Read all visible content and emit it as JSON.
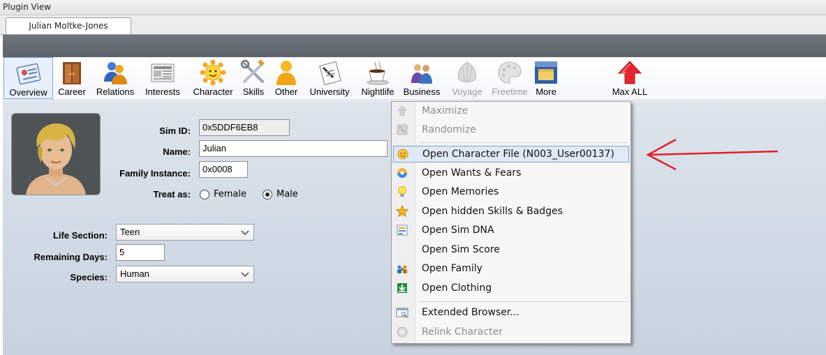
{
  "window": {
    "title": "Plugin View"
  },
  "tabs": [
    {
      "label": "Julian Moltke-Jones"
    }
  ],
  "toolbar": {
    "buttons": [
      {
        "label": "Overview",
        "icon": "overview-card-icon",
        "selected": true
      },
      {
        "label": "Career",
        "icon": "career-door-icon"
      },
      {
        "label": "Relations",
        "icon": "relations-people-icon"
      },
      {
        "label": "Interests",
        "icon": "interests-newspaper-icon"
      },
      {
        "label": "Character",
        "icon": "character-sun-icon"
      },
      {
        "label": "Skills",
        "icon": "skills-tools-icon"
      },
      {
        "label": "Other",
        "icon": "other-person-icon"
      },
      {
        "label": "University",
        "icon": "university-diploma-icon"
      },
      {
        "label": "Nightlife",
        "icon": "nightlife-cup-icon"
      },
      {
        "label": "Business",
        "icon": "business-people-icon"
      },
      {
        "label": "Voyage",
        "icon": "voyage-shell-icon",
        "disabled": true
      },
      {
        "label": "Freetime",
        "icon": "freetime-palette-icon",
        "disabled": true
      },
      {
        "label": "More",
        "icon": "more-folder-icon"
      },
      {
        "label": "Max ALL",
        "icon": "max-all-arrow-icon"
      }
    ]
  },
  "form": {
    "sim_id": {
      "label": "Sim ID:",
      "value": "0x5DDF6EB8"
    },
    "name": {
      "label": "Name:",
      "value": "Julian"
    },
    "family_instance": {
      "label": "Family Instance:",
      "value": "0x0008"
    },
    "treat_as": {
      "label": "Treat as:",
      "female": "Female",
      "male": "Male",
      "selected": "Male"
    },
    "life_section": {
      "label": "Life Section:",
      "value": "Teen"
    },
    "remaining_days": {
      "label": "Remaining Days:",
      "value": "5"
    },
    "species": {
      "label": "Species:",
      "value": "Human"
    }
  },
  "context_menu": {
    "items": [
      {
        "label": "Maximize",
        "icon": "maximize-arrow-icon",
        "disabled": true
      },
      {
        "label": "Randomize",
        "icon": "randomize-dice-icon",
        "disabled": true
      },
      {
        "label": "Open Character File (N003_User00137)",
        "icon": "character-file-icon",
        "highlighted": true
      },
      {
        "label": "Open Wants & Fears",
        "icon": "wants-fears-icon"
      },
      {
        "label": "Open Memories",
        "icon": "memories-lightbulb-icon"
      },
      {
        "label": "Open hidden Skills & Badges",
        "icon": "star-icon"
      },
      {
        "label": "Open Sim DNA",
        "icon": "sim-dna-icon"
      },
      {
        "label": "Open Sim Score",
        "icon": ""
      },
      {
        "label": "Open Family",
        "icon": "family-icon"
      },
      {
        "label": "Open Clothing",
        "icon": "clothing-download-icon"
      },
      {
        "label": "Extended Browser...",
        "icon": "browser-window-icon"
      },
      {
        "label": "Relink Character",
        "icon": "relink-icon",
        "disabled": true
      }
    ]
  },
  "colors": {
    "header_band": "#63696f",
    "panel_top": "#dde4ec",
    "panel_bottom": "#c7d2de",
    "highlight": "#dfe9f7",
    "annotation_arrow": "#e0202a"
  }
}
